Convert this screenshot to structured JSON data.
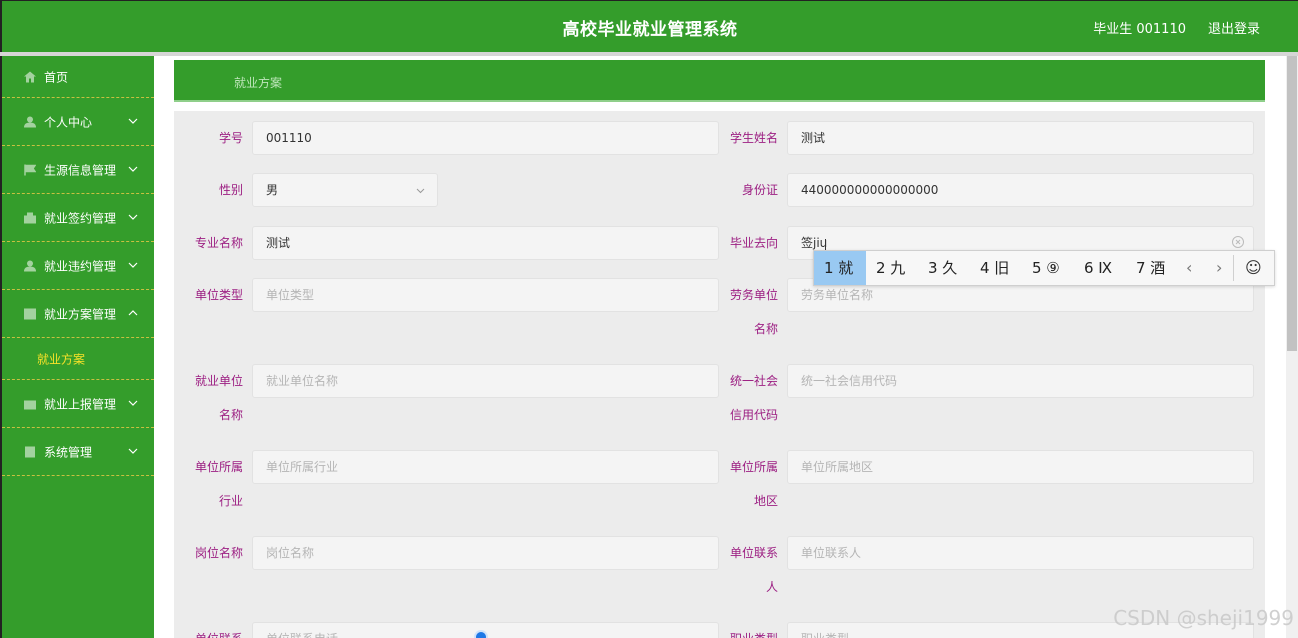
{
  "header": {
    "title": "高校毕业就业管理系统",
    "user": "毕业生 001110",
    "logout": "退出登录"
  },
  "sidebar": {
    "items": [
      {
        "label": "首页",
        "icon": "home-icon"
      },
      {
        "label": "个人中心",
        "icon": "user-icon"
      },
      {
        "label": "生源信息管理",
        "icon": "flag-icon"
      },
      {
        "label": "就业签约管理",
        "icon": "contract-icon"
      },
      {
        "label": "就业违约管理",
        "icon": "user-icon"
      },
      {
        "label": "就业方案管理",
        "icon": "list-icon"
      },
      {
        "label": "就业上报管理",
        "icon": "upload-icon"
      },
      {
        "label": "系统管理",
        "icon": "settings-icon"
      }
    ],
    "sub_item": "就业方案"
  },
  "breadcrumb": "就业方案",
  "form": {
    "student_id": {
      "label": "学号",
      "value": "001110"
    },
    "student_name": {
      "label": "学生姓名",
      "value": "测试"
    },
    "gender": {
      "label": "性别",
      "value": "男"
    },
    "id_card": {
      "label": "身份证",
      "value": "440000000000000000"
    },
    "major": {
      "label": "专业名称",
      "value": "测试"
    },
    "destination": {
      "label": "毕业去向",
      "value": "签jiu"
    },
    "unit_type": {
      "label": "单位类型",
      "placeholder": "单位类型"
    },
    "labor_unit": {
      "label1": "劳务单位",
      "label2": "名称",
      "placeholder": "劳务单位名称"
    },
    "employer": {
      "label1": "就业单位",
      "label2": "名称",
      "placeholder": "就业单位名称"
    },
    "credit_code": {
      "label1": "统一社会",
      "label2": "信用代码",
      "placeholder": "统一社会信用代码"
    },
    "industry": {
      "label1": "单位所属",
      "label2": "行业",
      "placeholder": "单位所属行业"
    },
    "region": {
      "label1": "单位所属",
      "label2": "地区",
      "placeholder": "单位所属地区"
    },
    "position": {
      "label": "岗位名称",
      "placeholder": "岗位名称"
    },
    "contact": {
      "label1": "单位联系",
      "label2": "人",
      "placeholder": "单位联系人"
    },
    "contact_phone": {
      "label": "单位联系",
      "placeholder": "单位联系电话"
    },
    "job_category": {
      "label": "职业类型",
      "placeholder": "职业类型"
    }
  },
  "ime": {
    "candidates": [
      "1 就",
      "2 九",
      "3 久",
      "4 旧",
      "5 ⑨",
      "6 Ⅸ",
      "7 酒"
    ],
    "prev": "‹",
    "next": "›",
    "emoji": "☺"
  },
  "watermark": "CSDN @sheji1999",
  "colors": {
    "primary": "#349d2b",
    "label": "#9c1e82",
    "active_sub": "#f7e229"
  }
}
